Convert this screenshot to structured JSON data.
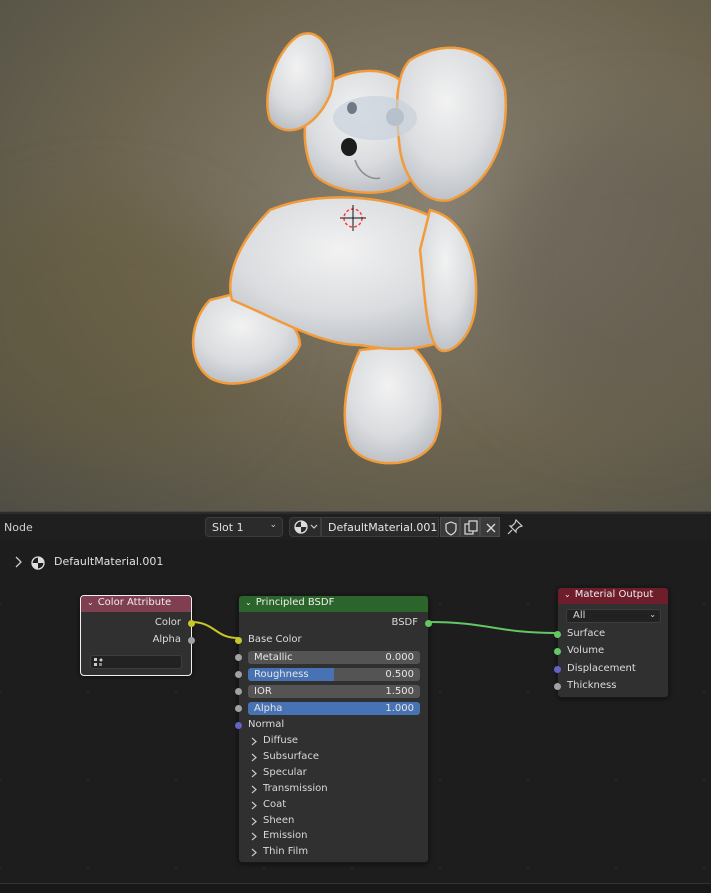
{
  "editor_header": {
    "mode_label": "Node",
    "slot": "Slot 1",
    "material_name": "DefaultMaterial.001"
  },
  "breadcrumb": {
    "material": "DefaultMaterial.001"
  },
  "nodes": {
    "color_attribute": {
      "title": "Color Attribute",
      "outputs": [
        "Color",
        "Alpha"
      ],
      "attribute_value": "",
      "header_color": "#803f51"
    },
    "principled_bsdf": {
      "title": "Principled BSDF",
      "output": "BSDF",
      "base_color_label": "Base Color",
      "fields": [
        {
          "label": "Metallic",
          "value": "0.000",
          "fraction": 0.0
        },
        {
          "label": "Roughness",
          "value": "0.500",
          "fraction": 0.5
        },
        {
          "label": "IOR",
          "value": "1.500",
          "fraction": 0.0
        },
        {
          "label": "Alpha",
          "value": "1.000",
          "fraction": 1.0
        }
      ],
      "normal_label": "Normal",
      "panels": [
        "Diffuse",
        "Subsurface",
        "Specular",
        "Transmission",
        "Coat",
        "Sheen",
        "Emission",
        "Thin Film"
      ],
      "header_color": "#2b652b"
    },
    "material_output": {
      "title": "Material Output",
      "target": "All",
      "inputs": [
        "Surface",
        "Volume",
        "Displacement",
        "Thickness"
      ],
      "header_color": "#6e1d2a"
    }
  },
  "colors": {
    "selection_outline": "#f29b3a",
    "link_color": "#c7c729",
    "shader_link": "#63c763",
    "field_fill": "#4772b3"
  }
}
